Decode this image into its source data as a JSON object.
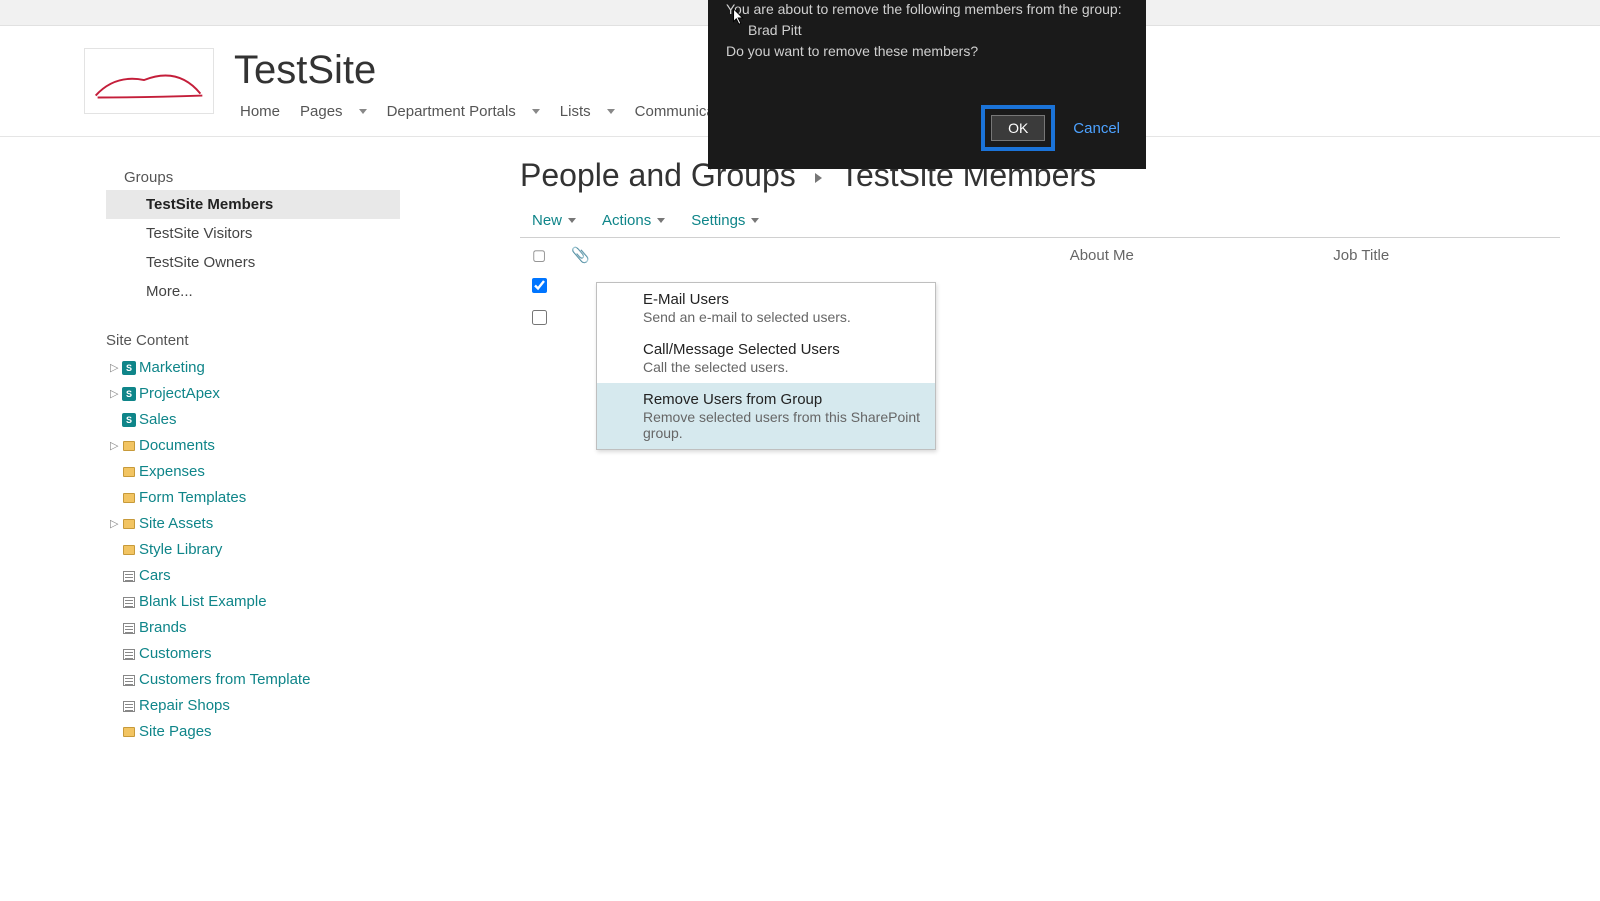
{
  "site": {
    "title": "TestSite"
  },
  "nav": {
    "items": [
      {
        "label": "Home",
        "has_dropdown": false
      },
      {
        "label": "Pages",
        "has_dropdown": true
      },
      {
        "label": "Department Portals",
        "has_dropdown": true
      },
      {
        "label": "Lists",
        "has_dropdown": true
      },
      {
        "label": "Communication",
        "has_dropdown": true
      }
    ]
  },
  "sidebar": {
    "groups_header": "Groups",
    "groups": [
      {
        "label": "TestSite Members",
        "active": true
      },
      {
        "label": "TestSite Visitors",
        "active": false
      },
      {
        "label": "TestSite Owners",
        "active": false
      },
      {
        "label": "More...",
        "active": false
      }
    ],
    "site_content_header": "Site Content",
    "tree": [
      {
        "label": "Marketing",
        "icon": "site",
        "caret": true
      },
      {
        "label": "ProjectApex",
        "icon": "site",
        "caret": true
      },
      {
        "label": "Sales",
        "icon": "site",
        "caret": false
      },
      {
        "label": "Documents",
        "icon": "folder",
        "caret": true
      },
      {
        "label": "Expenses",
        "icon": "folder",
        "caret": false
      },
      {
        "label": "Form Templates",
        "icon": "folder",
        "caret": false
      },
      {
        "label": "Site Assets",
        "icon": "folder",
        "caret": true
      },
      {
        "label": "Style Library",
        "icon": "folder",
        "caret": false
      },
      {
        "label": "Cars",
        "icon": "list",
        "caret": false
      },
      {
        "label": "Blank List Example",
        "icon": "list",
        "caret": false
      },
      {
        "label": "Brands",
        "icon": "list",
        "caret": false
      },
      {
        "label": "Customers",
        "icon": "list",
        "caret": false
      },
      {
        "label": "Customers from Template",
        "icon": "list",
        "caret": false
      },
      {
        "label": "Repair Shops",
        "icon": "list",
        "caret": false
      },
      {
        "label": "Site Pages",
        "icon": "folder",
        "caret": false
      }
    ]
  },
  "page": {
    "breadcrumb_parent": "People and Groups",
    "breadcrumb_current": "TestSite Members"
  },
  "toolbar": {
    "new": "New",
    "actions": "Actions",
    "settings": "Settings"
  },
  "table": {
    "columns": {
      "about": "About Me",
      "job": "Job Title"
    },
    "rows": [
      {
        "checked": true
      },
      {
        "checked": false
      }
    ]
  },
  "actions_menu": {
    "items": [
      {
        "title": "E-Mail Users",
        "desc": "Send an e-mail to selected users."
      },
      {
        "title": "Call/Message Selected Users",
        "desc": "Call the selected users."
      },
      {
        "title": "Remove Users from Group",
        "desc": "Remove selected users from this SharePoint group."
      }
    ]
  },
  "modal": {
    "line1": "You are about to remove the following members from the group:",
    "member": "Brad Pitt",
    "line2": "Do you want to remove these members?",
    "ok": "OK",
    "cancel": "Cancel"
  }
}
